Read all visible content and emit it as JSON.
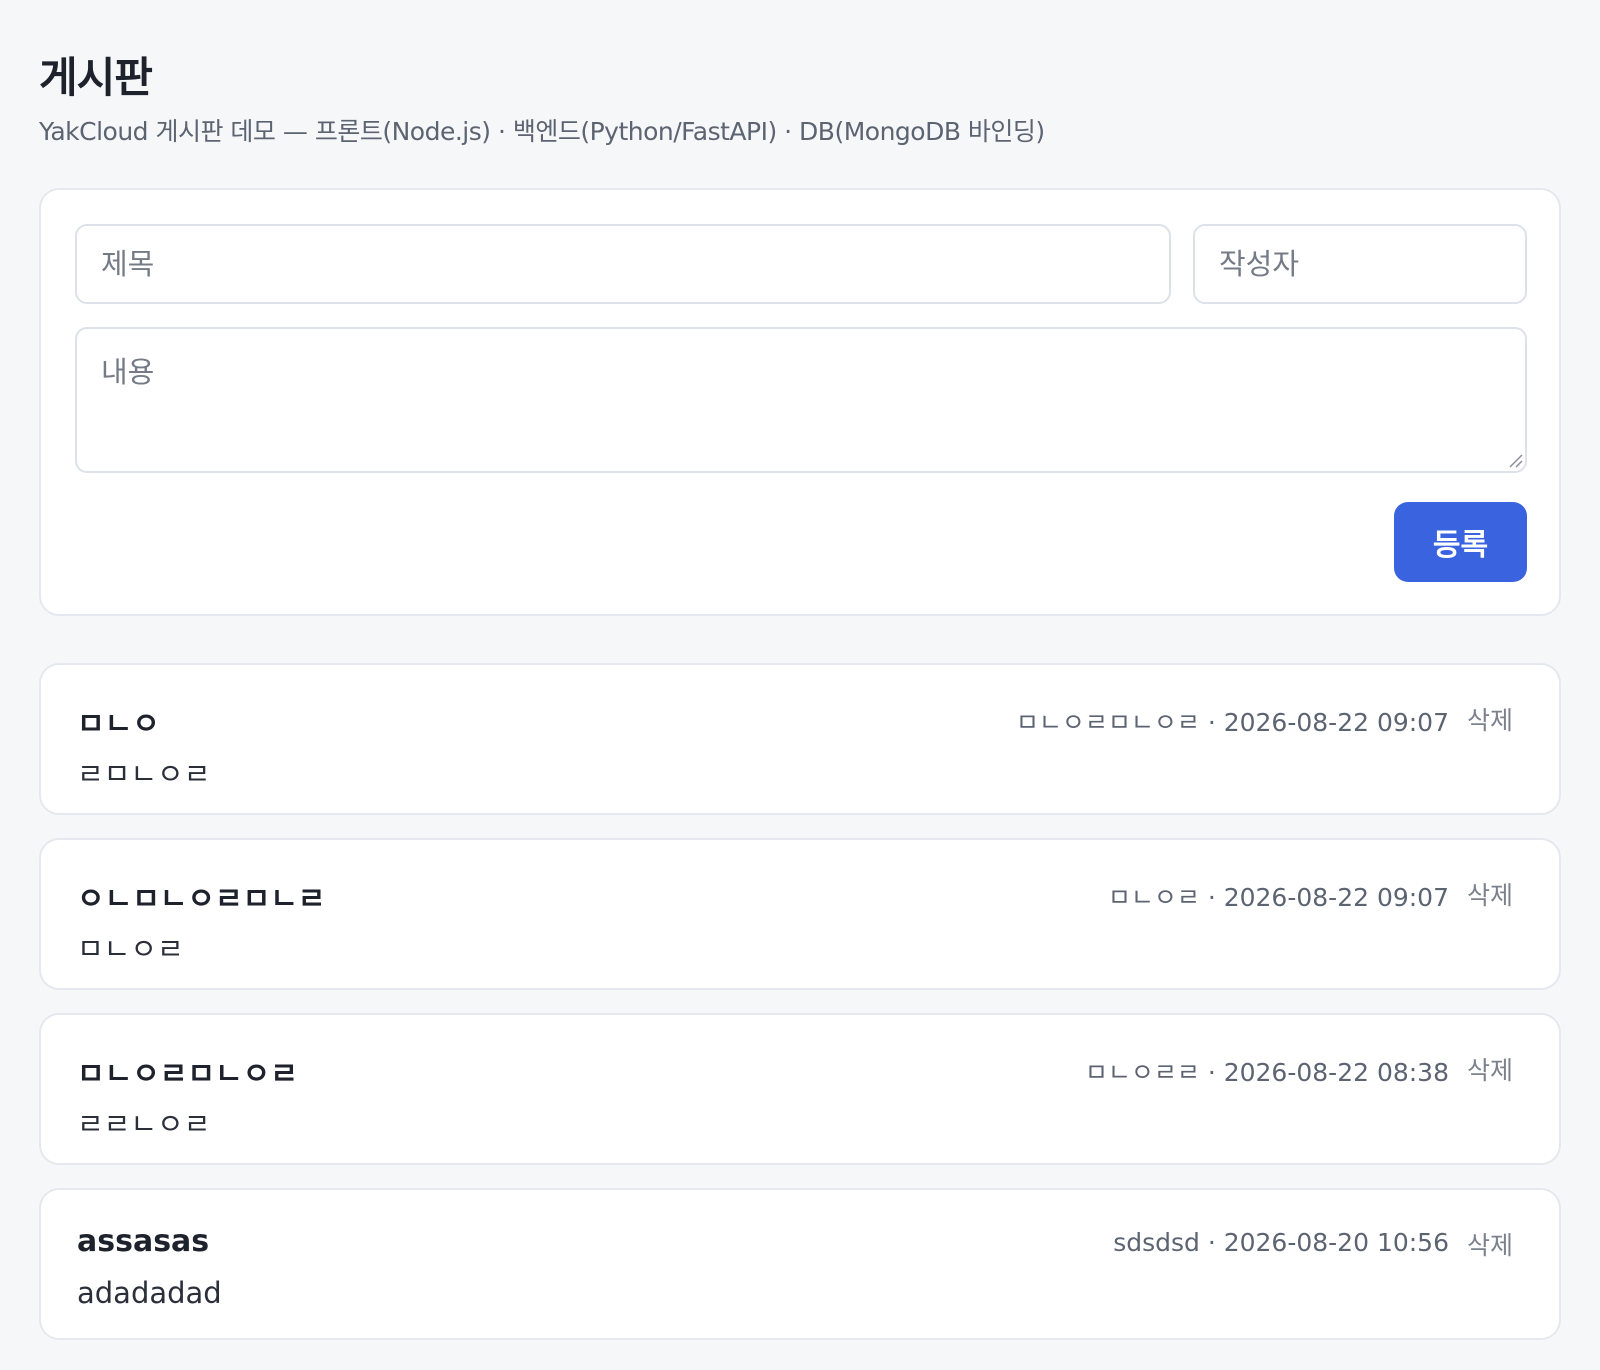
{
  "header": {
    "title": "게시판",
    "subtitle": "YakCloud 게시판 데모 — 프론트(Node.js) · 백엔드(Python/FastAPI) · DB(MongoDB 바인딩)"
  },
  "form": {
    "title_placeholder": "제목",
    "author_placeholder": "작성자",
    "content_placeholder": "내용",
    "submit_label": "등록"
  },
  "posts": [
    {
      "title": "ㅁㄴㅇ",
      "body": "ㄹㅁㄴㅇㄹ",
      "meta": "ㅁㄴㅇㄹㅁㄴㅇㄹ · 2026-08-22 09:07",
      "delete_label": "삭제"
    },
    {
      "title": "ㅇㄴㅁㄴㅇㄹㅁㄴㄹ",
      "body": "ㅁㄴㅇㄹ",
      "meta": "ㅁㄴㅇㄹ · 2026-08-22 09:07",
      "delete_label": "삭제"
    },
    {
      "title": "ㅁㄴㅇㄹㅁㄴㅇㄹ",
      "body": "ㄹㄹㄴㅇㄹ",
      "meta": "ㅁㄴㅇㄹㄹ · 2026-08-22 08:38",
      "delete_label": "삭제"
    },
    {
      "title": "assasas",
      "body": "adadadad",
      "meta": "sdsdsd · 2026-08-20 10:56",
      "delete_label": "삭제"
    }
  ]
}
